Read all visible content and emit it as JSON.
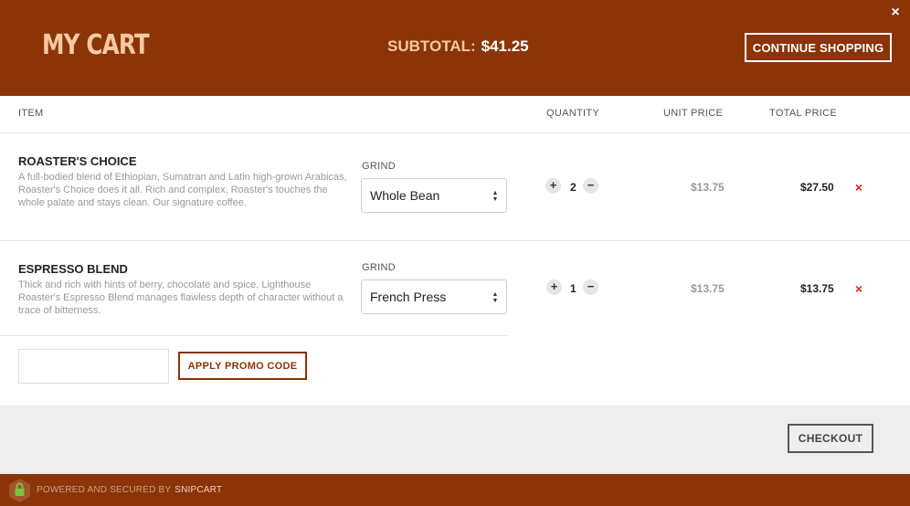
{
  "header": {
    "title": "MY CART",
    "subtotal_label": "SUBTOTAL:",
    "subtotal_value": "$41.25",
    "continue_label": "CONTINUE SHOPPING",
    "close_glyph": "×"
  },
  "columns": {
    "item": "ITEM",
    "quantity": "QUANTITY",
    "unit_price": "UNIT PRICE",
    "total_price": "TOTAL PRICE"
  },
  "items": [
    {
      "name": "ROASTER'S CHOICE",
      "description": "A full-bodied blend of Ethiopian, Sumatran and Latin high-grown Arabicas, Roaster's Choice does it all. Rich and complex, Roaster's touches the whole palate and stays clean. Our signature coffee.",
      "grind_label": "GRIND",
      "grind_value": "Whole Bean",
      "quantity": "2",
      "unit_price": "$13.75",
      "total_price": "$27.50"
    },
    {
      "name": "ESPRESSO BLEND",
      "description": "Thick and rich with hints of berry, chocolate and spice, Lighthouse Roaster's Espresso Blend manages flawless depth of character without a trace of bitterness.",
      "grind_label": "GRIND",
      "grind_value": "French Press",
      "quantity": "1",
      "unit_price": "$13.75",
      "total_price": "$13.75"
    }
  ],
  "controls": {
    "plus": "+",
    "minus": "−",
    "remove": "×",
    "select_arrows": "▲▼"
  },
  "promo": {
    "placeholder": "",
    "button_label": "APPLY PROMO CODE"
  },
  "checkout": {
    "label": "CHECKOUT"
  },
  "footer": {
    "powered_text": "POWERED AND SECURED BY",
    "brand": "SNIPCART"
  },
  "colors": {
    "brand_brown": "#8a3408",
    "title_peach": "#f7c9a1",
    "remove_red": "#e02020",
    "lock_green": "#7dc242"
  },
  "icons": [
    "close-icon",
    "plus-icon",
    "minus-icon",
    "remove-icon",
    "select-arrows-icon",
    "lock-icon"
  ]
}
